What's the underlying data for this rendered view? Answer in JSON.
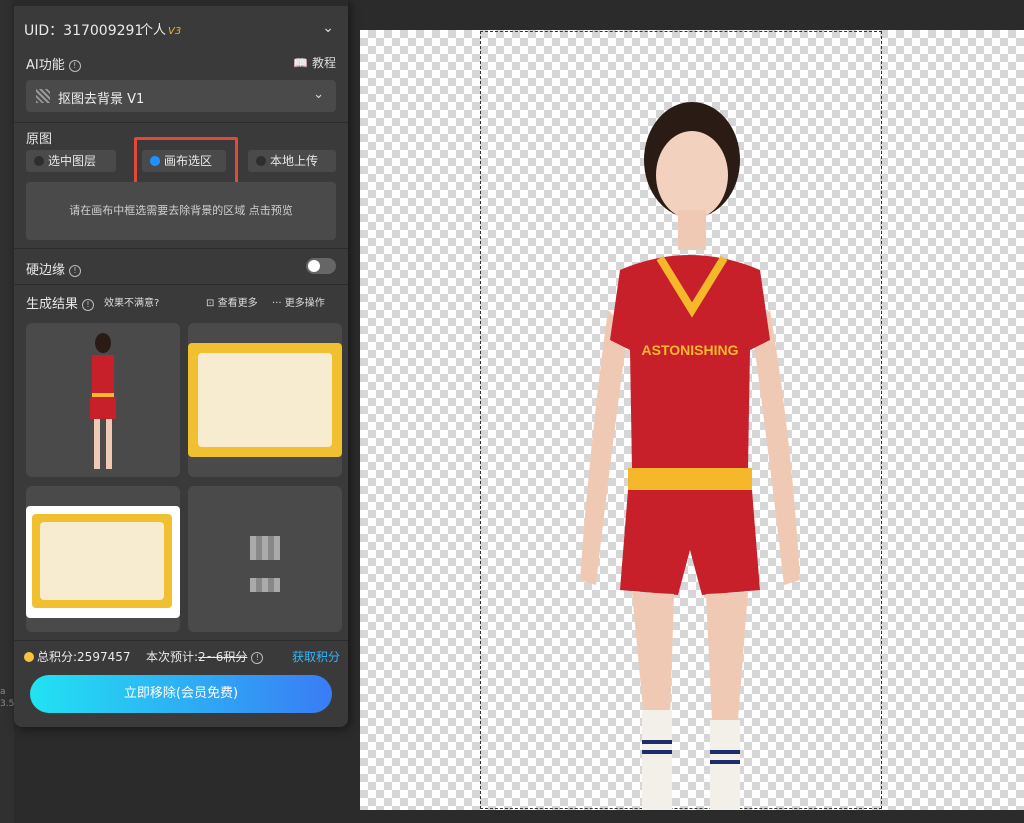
{
  "header": {
    "uid_text": "UID：317009291",
    "tier_label": "个人",
    "tier_badge": "V3"
  },
  "ai_feature": {
    "label": "AI功能",
    "tutorial_label": "教程",
    "selected_value": "抠图去背景 V1"
  },
  "source": {
    "label": "原图",
    "options": [
      {
        "label": "选中图层",
        "selected": false
      },
      {
        "label": "画布选区",
        "selected": true
      },
      {
        "label": "本地上传",
        "selected": false
      }
    ],
    "hint": "请在画布中框选需要去除背景的区域 点击预览"
  },
  "hard_edge": {
    "label": "硬边缘",
    "enabled": false
  },
  "results": {
    "label": "生成结果",
    "unsatisfied_label": "效果不满意?",
    "view_more_label": "查看更多",
    "more_ops_label": "··· 更多操作"
  },
  "points": {
    "total_label": "总积分:2597457",
    "estimate_prefix": "本次预计:",
    "estimate_value": "2~6积分",
    "get_points_label": "获取积分"
  },
  "cta_label": "立即移除(会员免费)",
  "side": {
    "version": "a\n3.5"
  },
  "colors": {
    "accent_blue": "#2fb9ff",
    "highlight_red": "#e04a3a",
    "cta_start": "#21e3f2",
    "cta_end": "#3a7cf5"
  }
}
